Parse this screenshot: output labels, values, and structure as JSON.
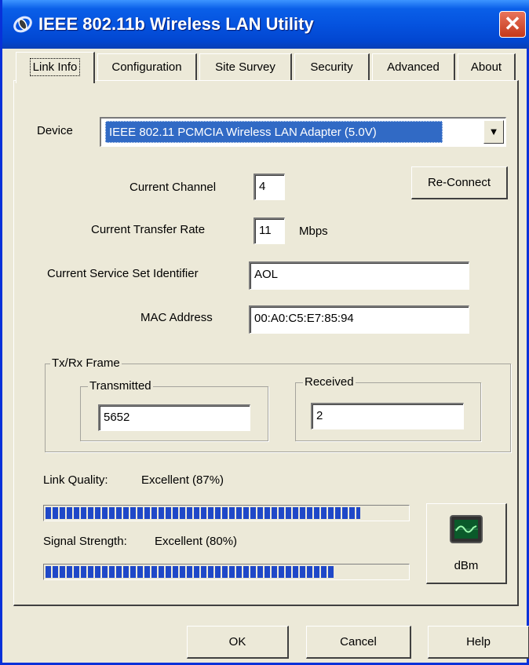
{
  "window": {
    "title": "IEEE 802.11b Wireless LAN Utility",
    "close_glyph": "✕",
    "app_icon": "wireless-app-icon"
  },
  "tabs": [
    {
      "label": "Link Info",
      "active": true
    },
    {
      "label": "Configuration",
      "active": false
    },
    {
      "label": "Site Survey",
      "active": false
    },
    {
      "label": "Security",
      "active": false
    },
    {
      "label": "Advanced",
      "active": false
    },
    {
      "label": "About",
      "active": false
    }
  ],
  "device": {
    "label": "Device",
    "value": "IEEE 802.11 PCMCIA Wireless LAN Adapter (5.0V)",
    "arrow": "▼"
  },
  "channel": {
    "label": "Current Channel",
    "value": "4"
  },
  "reconnect": {
    "label": "Re-Connect"
  },
  "rate": {
    "label": "Current Transfer Rate",
    "value": "11",
    "unit": "Mbps"
  },
  "ssid": {
    "label": "Current Service Set Identifier",
    "value": "AOL"
  },
  "mac": {
    "label": "MAC Address",
    "value": "00:A0:C5:E7:85:94"
  },
  "frames": {
    "label": "Tx/Rx Frame",
    "transmitted": {
      "label": "Transmitted",
      "value": "5652"
    },
    "received": {
      "label": "Received",
      "value": "2"
    }
  },
  "link_quality": {
    "label": "Link Quality:",
    "text": "Excellent (87%)",
    "percent": 87
  },
  "signal_strength": {
    "label": "Signal Strength:",
    "text": "Excellent (80%)",
    "percent": 80
  },
  "dbm_button": {
    "label": "dBm",
    "icon": "signal-monitor-icon"
  },
  "footer": {
    "ok": "OK",
    "cancel": "Cancel",
    "help": "Help"
  },
  "colors": {
    "title_bar": "#0553df",
    "progress": "#1f48c8",
    "selection": "#316ac5",
    "close": "#d5492b"
  }
}
